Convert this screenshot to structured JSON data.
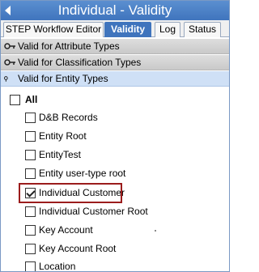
{
  "window": {
    "title": "Individual - Validity"
  },
  "tabs": [
    {
      "label": "STEP Workflow Editor",
      "active": false
    },
    {
      "label": "Validity",
      "active": true
    },
    {
      "label": "Log",
      "active": false
    },
    {
      "label": "Status",
      "active": false
    }
  ],
  "sections": [
    {
      "label": "Valid for Attribute Types"
    },
    {
      "label": "Valid for Classification Types"
    },
    {
      "label": "Valid for Entity Types"
    }
  ],
  "entity_types": {
    "all_label": "All",
    "items": [
      {
        "label": "D&B Records",
        "checked": false
      },
      {
        "label": "Entity Root",
        "checked": false
      },
      {
        "label": "EntityTest",
        "checked": false
      },
      {
        "label": "Entity user-type root",
        "checked": false
      },
      {
        "label": "Individual Customer",
        "checked": true
      },
      {
        "label": "Individual Customer Root",
        "checked": false
      },
      {
        "label": "Key Account",
        "checked": false
      },
      {
        "label": "Key Account Root",
        "checked": false
      },
      {
        "label": "Location",
        "checked": false
      }
    ]
  },
  "colors": {
    "title_bar": "#3f74bd",
    "highlight_border": "#9b1c1c",
    "active_section": "#cfe0f6"
  }
}
